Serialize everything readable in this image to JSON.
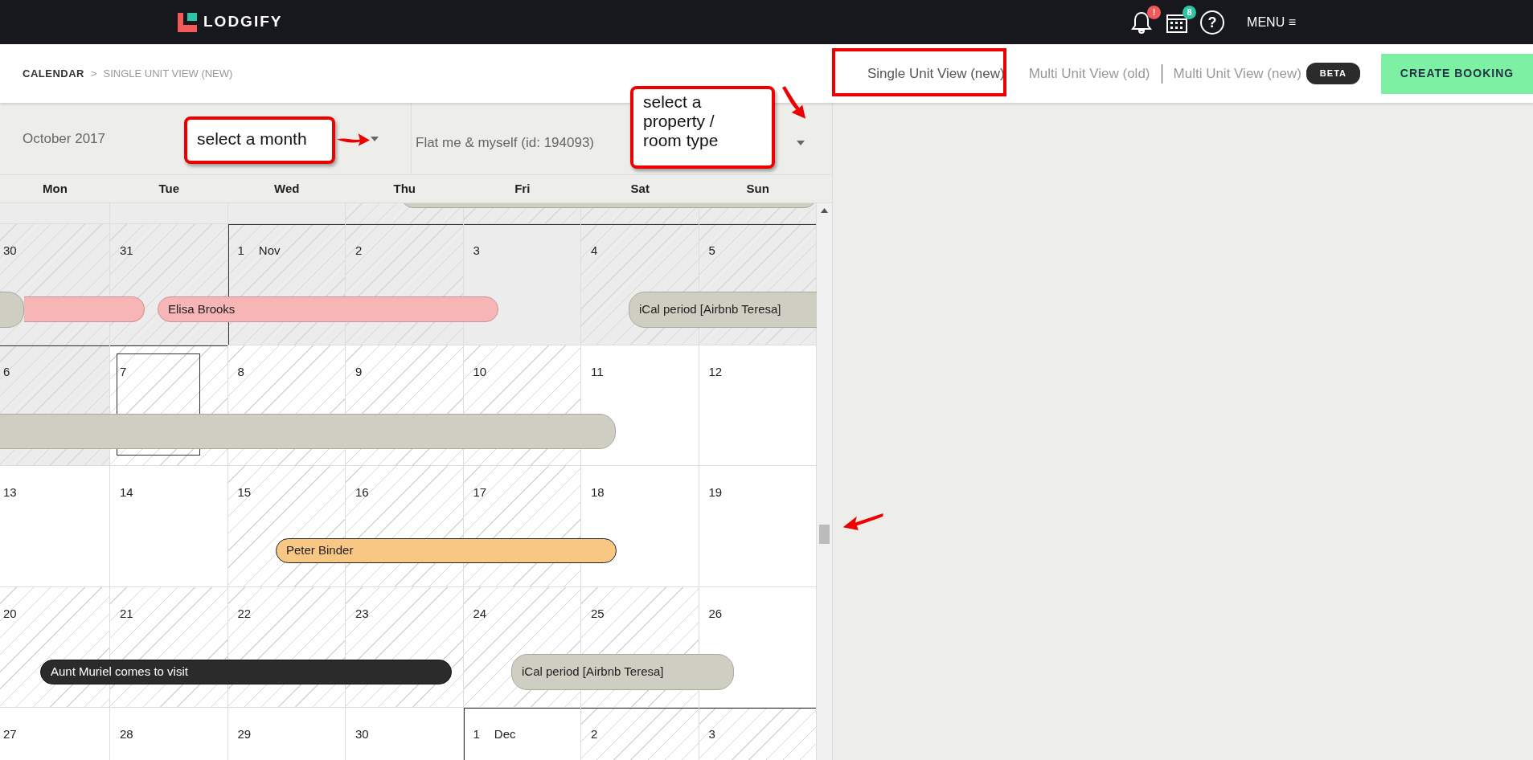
{
  "topbar": {
    "logo": "LODGIFY",
    "notification_badge": "!",
    "calendar_badge": "8",
    "help": "?",
    "menu": "MENU",
    "menu_icon": "≡"
  },
  "breadcrumb": {
    "root": "CALENDAR",
    "separator": ">",
    "current": "SINGLE UNIT VIEW (NEW)"
  },
  "view_tabs": [
    {
      "label": "Single Unit View (new)",
      "selected": true
    },
    {
      "label": "Multi Unit View (old)",
      "selected": false
    },
    {
      "label": "Multi Unit View (new)",
      "selected": false,
      "badge": "BETA"
    }
  ],
  "create_button": "CREATE BOOKING",
  "month_select": {
    "value": "October 2017"
  },
  "property_select": {
    "value": "Flat me & myself (id: 194093)"
  },
  "weekdays": [
    "Mon",
    "Tue",
    "Wed",
    "Thu",
    "Fri",
    "Sat",
    "Sun"
  ],
  "weeks": [
    {
      "days": [
        {
          "past": true,
          "hatched": false
        },
        {
          "past": true,
          "hatched": false
        },
        {
          "past": true,
          "hatched": false
        },
        {
          "past": true,
          "hatched": true
        },
        {
          "past": true,
          "hatched": true
        },
        {
          "past": true,
          "hatched": true
        },
        {
          "past": true,
          "hatched": true
        }
      ],
      "events": [
        {
          "color": "#cfcec3"
        }
      ]
    },
    {
      "days": [
        {
          "label": "30",
          "past": true,
          "hatched": true
        },
        {
          "label": "31",
          "past": true,
          "hatched": true
        },
        {
          "label": "1",
          "month": "Nov",
          "past": true,
          "hatched": true
        },
        {
          "label": "2",
          "past": true,
          "hatched": true
        },
        {
          "label": "3",
          "past": true,
          "hatched": false
        },
        {
          "label": "4",
          "past": true,
          "hatched": true
        },
        {
          "label": "5",
          "past": true,
          "hatched": true
        }
      ],
      "events": [
        {
          "color": "#cfcec3"
        },
        {
          "color": "#f7b5b5"
        },
        {
          "label": "Elisa Brooks",
          "color": "#f7b5b5"
        },
        {
          "label": "iCal period [Airbnb Teresa]",
          "color": "#cfcec3"
        }
      ]
    },
    {
      "days": [
        {
          "label": "6",
          "past": true,
          "hatched": true
        },
        {
          "label": "7",
          "today": true,
          "hatched": true
        },
        {
          "label": "8",
          "hatched": true
        },
        {
          "label": "9",
          "hatched": true
        },
        {
          "label": "10",
          "hatched": true
        },
        {
          "label": "11",
          "hatched": false
        },
        {
          "label": "12",
          "hatched": false
        }
      ],
      "events": [
        {
          "color": "#cfcec3"
        }
      ]
    },
    {
      "days": [
        {
          "label": "13",
          "hatched": false
        },
        {
          "label": "14",
          "hatched": false
        },
        {
          "label": "15",
          "hatched": true
        },
        {
          "label": "16",
          "hatched": true
        },
        {
          "label": "17",
          "hatched": true
        },
        {
          "label": "18",
          "hatched": false
        },
        {
          "label": "19",
          "hatched": false
        }
      ],
      "events": [
        {
          "label": "Peter Binder",
          "color": "#f7c783"
        }
      ]
    },
    {
      "days": [
        {
          "label": "20",
          "hatched": true
        },
        {
          "label": "21",
          "hatched": true
        },
        {
          "label": "22",
          "hatched": true
        },
        {
          "label": "23",
          "hatched": true
        },
        {
          "label": "24",
          "hatched": true
        },
        {
          "label": "25",
          "hatched": true
        },
        {
          "label": "26",
          "hatched": false
        }
      ],
      "events": [
        {
          "label": "Aunt Muriel comes to visit",
          "color": "#2b2b2b"
        },
        {
          "label": "iCal period [Airbnb Teresa]",
          "color": "#cfcec3"
        }
      ]
    },
    {
      "days": [
        {
          "label": "27",
          "hatched": false
        },
        {
          "label": "28",
          "hatched": false
        },
        {
          "label": "29",
          "hatched": false
        },
        {
          "label": "30",
          "hatched": false
        },
        {
          "label": "1",
          "month": "Dec",
          "hatched": false
        },
        {
          "label": "2",
          "hatched": true
        },
        {
          "label": "3",
          "hatched": true
        }
      ]
    }
  ],
  "annotations": [
    {
      "text": "select a month"
    },
    {
      "text": "select a property / room type"
    }
  ]
}
